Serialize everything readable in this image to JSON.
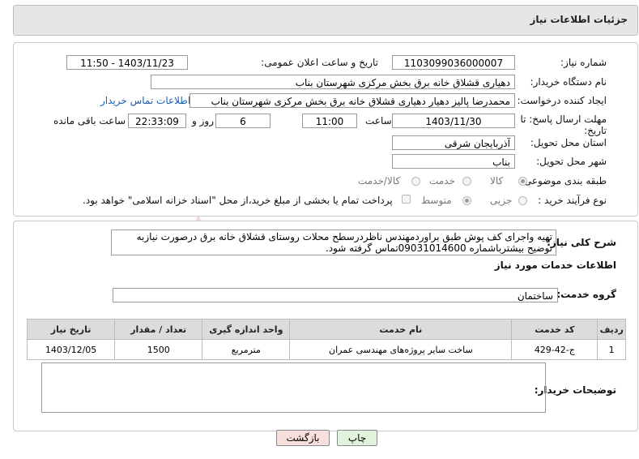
{
  "header": {
    "title": "جزئیات اطلاعات نیاز"
  },
  "form": {
    "need_number_label": "شماره نیاز:",
    "need_number": "1103099036000007",
    "announce_label": "تاریخ و ساعت اعلان عمومی:",
    "announce_value": "1403/11/23 - 11:50",
    "buyer_org_label": "نام دستگاه خریدار:",
    "buyer_org": "دهیاری قشلاق خانه برق بخش مرکزی شهرستان بناب",
    "creator_label": "ایجاد کننده درخواست:",
    "creator": "محمدرضا پالیز دهیار دهیاری قشلاق خانه برق بخش مرکزی شهرستان بناب",
    "contact_link": "اطلاعات تماس خریدار",
    "deadline_label": "مهلت ارسال پاسخ: تا تاریخ:",
    "deadline_date": "1403/11/30",
    "time_label": "ساعت",
    "deadline_time": "11:00",
    "days_value": "6",
    "days_label": "روز و",
    "remaining_time": "22:33:09",
    "remaining_label": "ساعت باقی مانده",
    "province_label": "استان محل تحویل:",
    "province": "آذربایجان شرقی",
    "city_label": "شهر محل تحویل:",
    "city": "بناب",
    "category_label": "طبقه بندی موضوعی:",
    "category_options": [
      "کالا",
      "خدمت",
      "کالا/خدمت"
    ],
    "process_label": "نوع فرآیند خرید :",
    "process_options": [
      "جزیی",
      "متوسط"
    ],
    "treasury_note": "پرداخت تمام یا بخشی از مبلغ خرید،از محل \"اسناد خزانه اسلامی\" خواهد بود."
  },
  "summary": {
    "label": "شرح کلی نیاز:",
    "text": "تهیه واجرای کف پوش طبق براوردمهندس ناظردرسطح محلات روستای قشلاق خانه برق درصورت نیازبه توضیح بیشترباشماره 09031014600تماس گرفته شود."
  },
  "services": {
    "section_title": "اطلاعات خدمات مورد نیاز",
    "group_label": "گروه خدمت:",
    "group_value": "ساختمان",
    "columns": [
      "ردیف",
      "کد خدمت",
      "نام خدمت",
      "واحد اندازه گیری",
      "تعداد / مقدار",
      "تاریخ نیاز"
    ],
    "rows": [
      [
        "1",
        "ج-42-429",
        "ساخت سایر پروژه‌های مهندسی عمران",
        "مترمربع",
        "1500",
        "1403/12/05"
      ]
    ]
  },
  "buyer_notes": {
    "label": "توضیحات خریدار:",
    "value": ""
  },
  "buttons": {
    "print": "چاپ",
    "back": "بازگشت"
  },
  "colors": {
    "watermark": "#e9b9b9",
    "back_button_bg": "#f9dede",
    "print_button_bg": "#e2f3dc"
  }
}
